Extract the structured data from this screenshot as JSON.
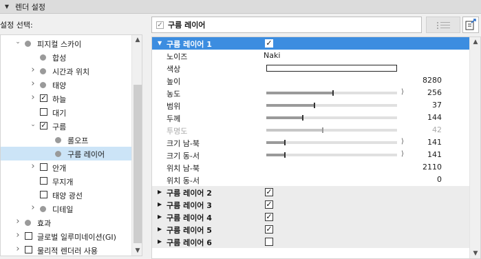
{
  "header": {
    "title": "렌더 설정"
  },
  "left": {
    "label": "설정 선택:",
    "tree": [
      {
        "label": "피지컬 스카이",
        "chev": "down",
        "marker": "dot",
        "indent": 0
      },
      {
        "label": "합성",
        "chev": "",
        "marker": "dot",
        "indent": 1
      },
      {
        "label": "시간과 위치",
        "chev": "right",
        "marker": "dot",
        "indent": 1
      },
      {
        "label": "태양",
        "chev": "right",
        "marker": "dot",
        "indent": 1
      },
      {
        "label": "하늘",
        "chev": "right",
        "marker": "checked",
        "indent": 1
      },
      {
        "label": "대기",
        "chev": "",
        "marker": "unchecked",
        "indent": 1
      },
      {
        "label": "구름",
        "chev": "down",
        "marker": "checked",
        "indent": 1
      },
      {
        "label": "롤오프",
        "chev": "",
        "marker": "dot",
        "indent": 2
      },
      {
        "label": "구름 레이어",
        "chev": "",
        "marker": "dot",
        "indent": 2,
        "selected": true
      },
      {
        "label": "안개",
        "chev": "right",
        "marker": "unchecked",
        "indent": 1
      },
      {
        "label": "무지개",
        "chev": "",
        "marker": "unchecked",
        "indent": 1
      },
      {
        "label": "태양 광선",
        "chev": "",
        "marker": "unchecked",
        "indent": 1
      },
      {
        "label": "디테일",
        "chev": "right",
        "marker": "dot",
        "indent": 1
      },
      {
        "label": "효과",
        "chev": "right",
        "marker": "dot",
        "indent": 0
      },
      {
        "label": "글로벌 일루미네이션(GI)",
        "chev": "right",
        "marker": "unchecked",
        "indent": 0
      },
      {
        "label": "물리적 렌더러 사용",
        "chev": "right",
        "marker": "unchecked",
        "indent": 0
      }
    ]
  },
  "right": {
    "field_label": "구름 레이어",
    "rows": [
      {
        "kind": "group",
        "name": "구름 레이어 1",
        "expanded": true,
        "checked": true,
        "active": true
      },
      {
        "kind": "text",
        "name": "노이즈",
        "value": "Naki"
      },
      {
        "kind": "color",
        "name": "색상",
        "color": "#ffffff"
      },
      {
        "kind": "number",
        "name": "높이",
        "value": "8280"
      },
      {
        "kind": "slider",
        "name": "농도",
        "value": "256",
        "level": 0.51,
        "arrow": true
      },
      {
        "kind": "slider",
        "name": "범위",
        "value": "37",
        "level": 0.37
      },
      {
        "kind": "slider",
        "name": "두께",
        "value": "144",
        "level": 0.28
      },
      {
        "kind": "slider",
        "name": "투명도",
        "value": "42",
        "level": 0.43,
        "disabled": true
      },
      {
        "kind": "slider",
        "name": "크기 남-북",
        "value": "141",
        "level": 0.14,
        "arrow": true
      },
      {
        "kind": "slider",
        "name": "크기 동-서",
        "value": "141",
        "level": 0.14,
        "arrow": true
      },
      {
        "kind": "number",
        "name": "위치 남-북",
        "value": "2110"
      },
      {
        "kind": "number",
        "name": "위치 동-서",
        "value": "0"
      },
      {
        "kind": "group",
        "name": "구름 레이어 2",
        "expanded": false,
        "checked": true
      },
      {
        "kind": "group",
        "name": "구름 레이어 3",
        "expanded": false,
        "checked": true
      },
      {
        "kind": "group",
        "name": "구름 레이어 4",
        "expanded": false,
        "checked": true
      },
      {
        "kind": "group",
        "name": "구름 레이어 5",
        "expanded": false,
        "checked": true
      },
      {
        "kind": "group",
        "name": "구름 레이어 6",
        "expanded": false,
        "checked": false
      }
    ]
  },
  "colors": {
    "accent": "#3c8de0",
    "selection": "#cce4f7"
  }
}
